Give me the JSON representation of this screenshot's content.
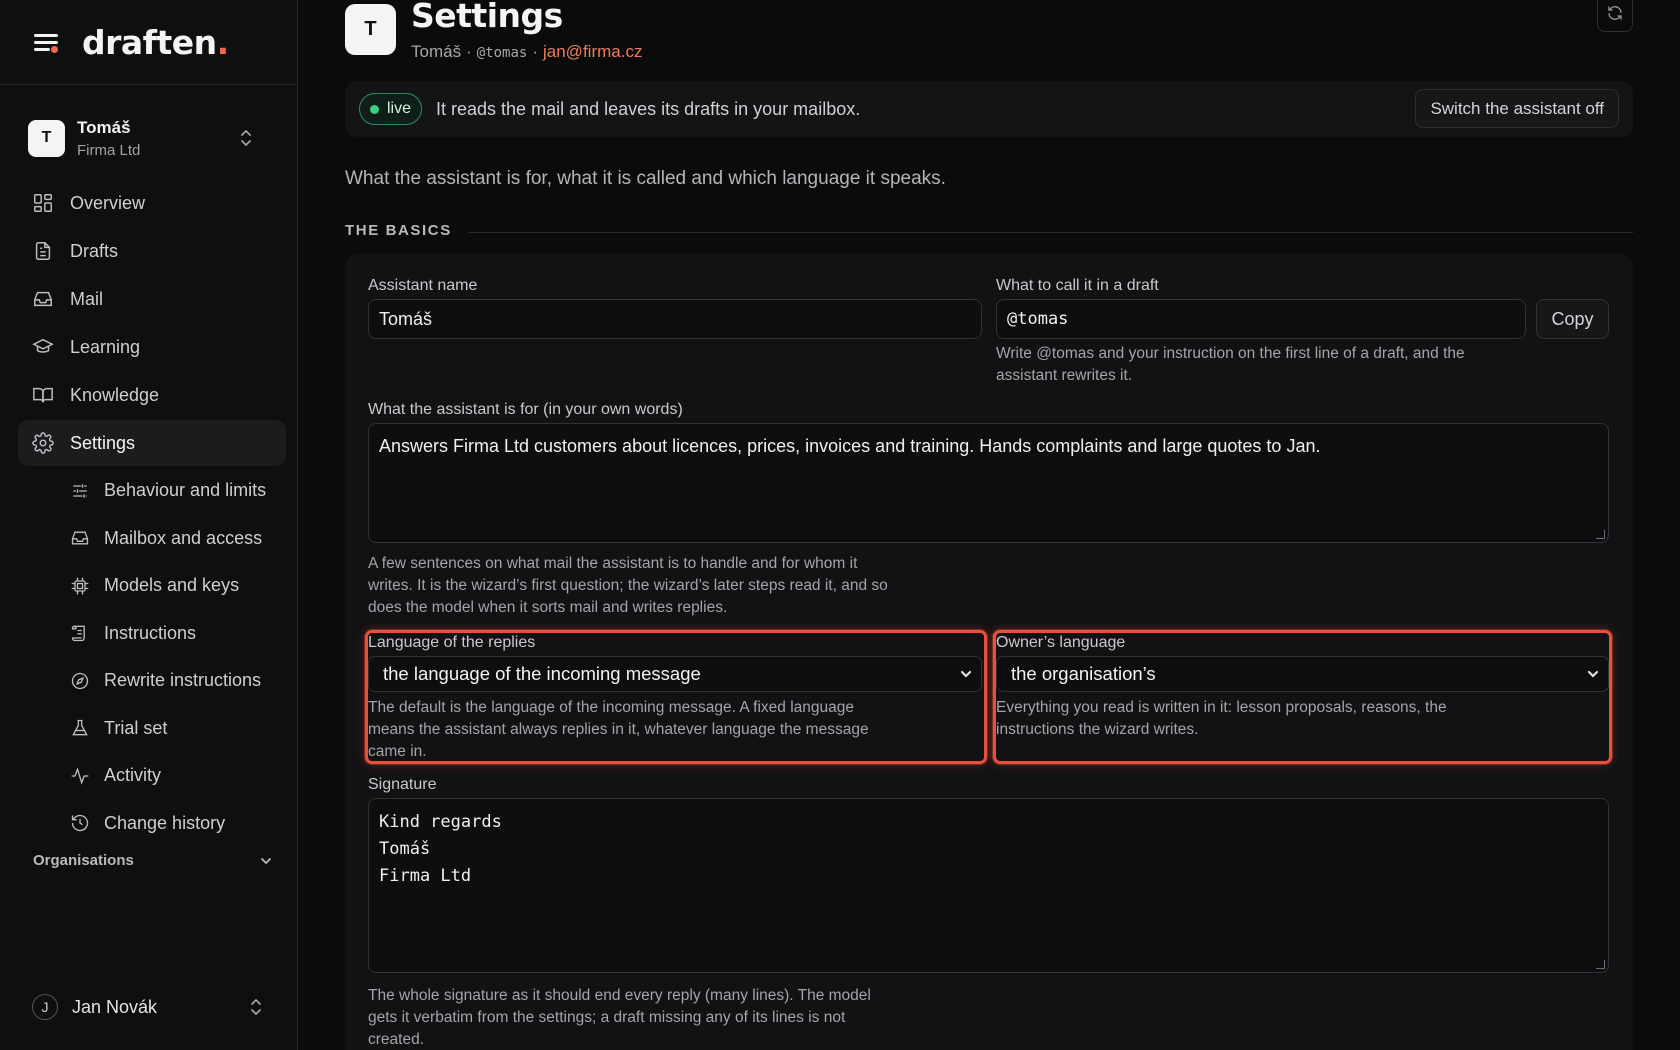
{
  "brand": {
    "name": "draften",
    "dot": "."
  },
  "org": {
    "initial": "T",
    "name": "Tomáš",
    "sub": "Firma Ltd"
  },
  "nav": {
    "items": [
      {
        "label": "Overview"
      },
      {
        "label": "Drafts"
      },
      {
        "label": "Mail"
      },
      {
        "label": "Learning"
      },
      {
        "label": "Knowledge"
      },
      {
        "label": "Settings"
      }
    ],
    "sub_items": [
      {
        "label": "Behaviour and limits"
      },
      {
        "label": "Mailbox and access"
      },
      {
        "label": "Models and keys"
      },
      {
        "label": "Instructions"
      },
      {
        "label": "Rewrite instructions"
      },
      {
        "label": "Trial set"
      },
      {
        "label": "Activity"
      },
      {
        "label": "Change history"
      }
    ]
  },
  "organisations_label": "Organisations",
  "user": {
    "initial": "J",
    "name": "Jan Novák"
  },
  "header": {
    "initial": "T",
    "title": "Settings",
    "name": "Tomáš",
    "sep1": "·",
    "handle": "@tomas",
    "sep2": "·",
    "email": "jan@firma.cz"
  },
  "status": {
    "badge": "live",
    "text": "It reads the mail and leaves its drafts in your mailbox.",
    "switch_label": "Switch the assistant off"
  },
  "intro": "What the assistant is for, what it is called and which language it speaks.",
  "section_title": "THE BASICS",
  "form": {
    "assistant_name_label": "Assistant name",
    "assistant_name_value": "Tomáš",
    "call_label": "What to call it in a draft",
    "call_value": "@tomas",
    "copy_label": "Copy",
    "call_help": "Write @tomas and your instruction on the first line of a draft, and the assistant rewrites it.",
    "purpose_label": "What the assistant is for (in your own words)",
    "purpose_value": "Answers Firma Ltd customers about licences, prices, invoices and training. Hands complaints and large quotes to Jan.",
    "purpose_help": "A few sentences on what mail the assistant is to handle and for whom it writes. It is the wizard’s first question; the wizard’s later steps read it, and so does the model when it sorts mail and writes replies.",
    "reply_lang_label": "Language of the replies",
    "reply_lang_value": "the language of the incoming message",
    "reply_lang_help": "The default is the language of the incoming message. A fixed language means the assistant always replies in it, whatever language the message came in.",
    "owner_lang_label": "Owner’s language",
    "owner_lang_value": "the organisation’s",
    "owner_lang_help": "Everything you read is written in it: lesson proposals, reasons, the instructions the wizard writes.",
    "signature_label": "Signature",
    "signature_value": "Kind regards\nTomáš\nFirma Ltd",
    "signature_help": "The whole signature as it should end every reply (many lines). The model gets it verbatim from the settings; a draft missing any of its lines is not created."
  },
  "colors": {
    "accent": "#f0674f",
    "live": "#3ccf7f",
    "highlight": "#e8503d"
  }
}
